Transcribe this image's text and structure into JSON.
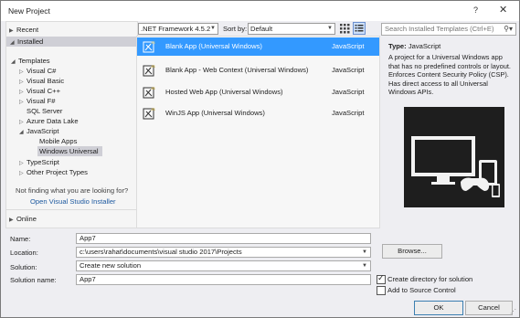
{
  "window": {
    "title": "New Project",
    "help": "?",
    "close": "✕"
  },
  "tree": {
    "recent": "Recent",
    "installed": "Installed",
    "templates": "Templates",
    "items": {
      "visual_csharp": "Visual C#",
      "visual_basic": "Visual Basic",
      "visual_cpp": "Visual C++",
      "visual_fsharp": "Visual F#",
      "sql_server": "SQL Server",
      "azure_data_lake": "Azure Data Lake",
      "javascript": "JavaScript",
      "mobile_apps": "Mobile Apps",
      "windows_universal": "Windows Universal",
      "typescript": "TypeScript",
      "other_project_types": "Other Project Types"
    },
    "not_finding": "Not finding what you are looking for?",
    "installer_link": "Open Visual Studio Installer",
    "online": "Online"
  },
  "toolbar": {
    "framework": ".NET Framework 4.5.2",
    "sort_label": "Sort by:",
    "sort_value": "Default",
    "search_placeholder": "Search Installed Templates (Ctrl+E)"
  },
  "templates": [
    {
      "name": "Blank App (Universal Windows)",
      "lang": "JavaScript",
      "selected": true
    },
    {
      "name": "Blank App - Web Context (Universal Windows)",
      "lang": "JavaScript",
      "selected": false
    },
    {
      "name": "Hosted Web App (Universal Windows)",
      "lang": "JavaScript",
      "selected": false
    },
    {
      "name": "WinJS App (Universal Windows)",
      "lang": "JavaScript",
      "selected": false
    }
  ],
  "description": {
    "type_label": "Type:",
    "type_value": "JavaScript",
    "text": "A project for a Universal Windows app that has no predefined controls or layout. Enforces Content Security Policy (CSP). Has direct access to all Universal Windows APIs."
  },
  "form": {
    "name_label": "Name:",
    "name_value": "App7",
    "location_label": "Location:",
    "location_value": "c:\\users\\rahat\\documents\\visual studio 2017\\Projects",
    "solution_label": "Solution:",
    "solution_value": "Create new solution",
    "solution_name_label": "Solution name:",
    "solution_name_value": "App7",
    "browse": "Browse...",
    "create_dir": "Create directory for solution",
    "create_dir_checked": true,
    "add_source_control": "Add to Source Control",
    "add_source_control_checked": false,
    "ok": "OK",
    "cancel": "Cancel"
  },
  "colors": {
    "selection": "#3399ff",
    "tree_selection": "#cfcfd6",
    "link": "#1e5aa0"
  }
}
